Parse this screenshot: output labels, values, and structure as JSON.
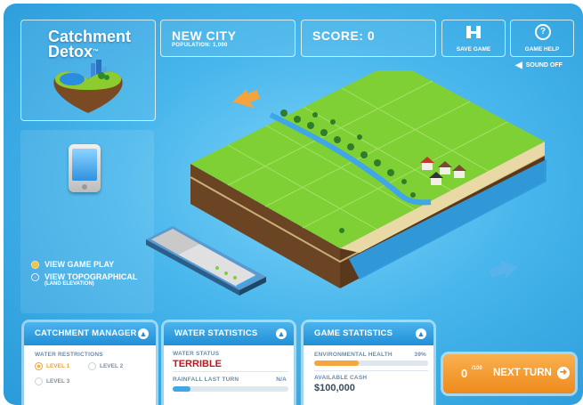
{
  "logo": {
    "line1": "Catchment",
    "line2": "Detox",
    "tm": "™"
  },
  "city": {
    "name": "NEW CITY",
    "population": "POPULATION: 1,000"
  },
  "score": {
    "label": "SCORE: 0"
  },
  "toolbar": {
    "save_label": "SAVE GAME",
    "help_label": "GAME HELP",
    "sound_label": "SOUND OFF",
    "save_icon": "save-icon",
    "help_icon": "help-icon"
  },
  "view_options": [
    {
      "label": "VIEW GAME PLAY",
      "sub": "",
      "selected": true
    },
    {
      "label": "VIEW TOPOGRAPHICAL",
      "sub": "(LAND ELEVATION)",
      "selected": false
    }
  ],
  "catchment_manager": {
    "title": "CATCHMENT MANAGER",
    "restrictions_label": "WATER RESTRICTIONS",
    "levels": [
      {
        "label": "LEVEL 1",
        "selected": true
      },
      {
        "label": "LEVEL 2",
        "selected": false
      },
      {
        "label": "LEVEL 3",
        "selected": false
      }
    ]
  },
  "water_statistics": {
    "title": "WATER STATISTICS",
    "status_label": "WATER STATUS",
    "status_value": "TERRIBLE",
    "rainfall_label": "RAINFALL LAST TURN",
    "rainfall_value": "N/A",
    "rainfall_level": 0.15
  },
  "game_statistics": {
    "title": "GAME STATISTICS",
    "env_health_label": "ENVIRONMENTAL HEALTH",
    "env_health_value": "39%",
    "env_health_level": 0.39,
    "cash_label": "AVAILABLE CASH",
    "cash_value": "$100,000"
  },
  "next_turn": {
    "count": "0",
    "total": "/100",
    "label": "NEXT TURN"
  },
  "colors": {
    "accent_orange": "#ee8a1c",
    "panel_blue": "#1f8fd6",
    "status_red": "#c0141b",
    "grass": "#7fd035"
  }
}
